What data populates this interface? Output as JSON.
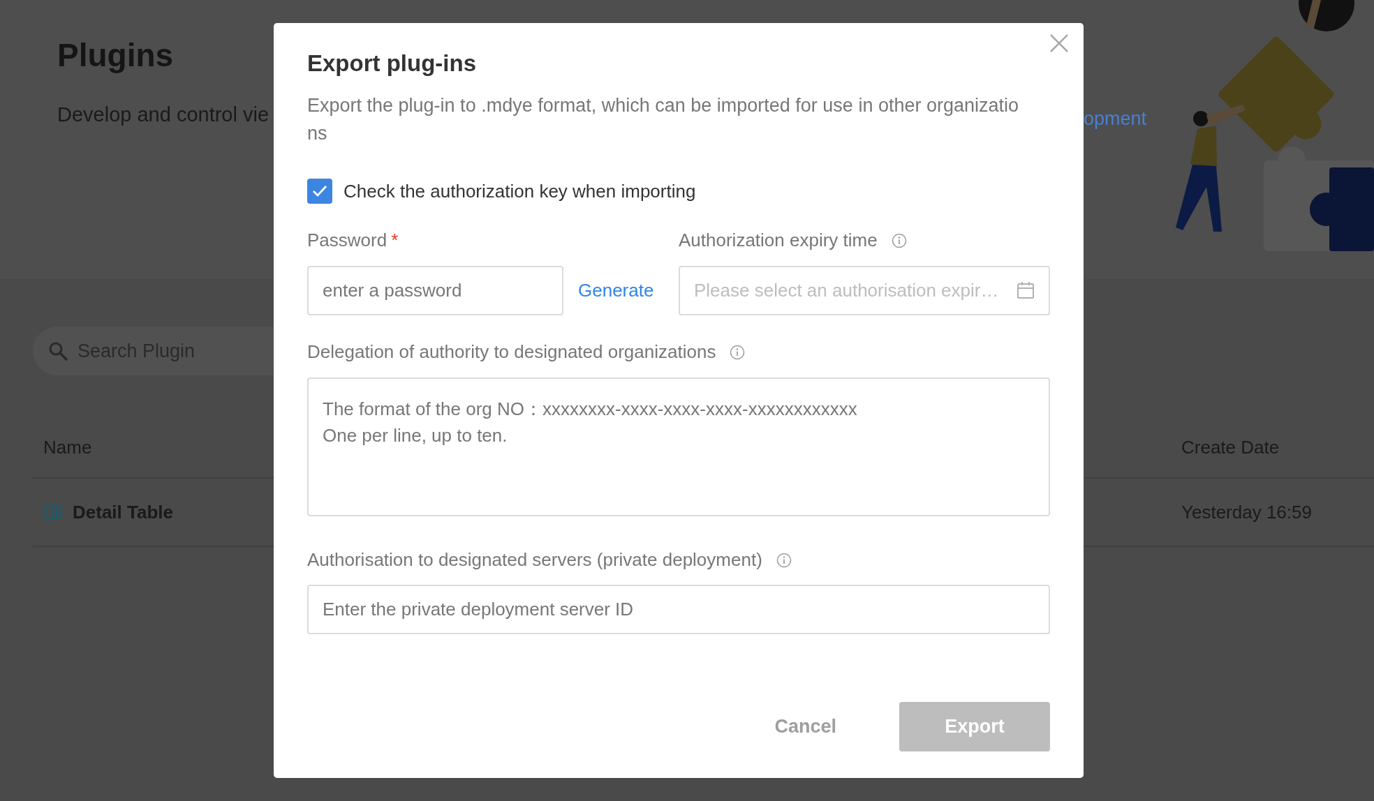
{
  "page": {
    "title": "Plugins",
    "subtitle": "Develop and control vie",
    "link": "opment",
    "search": {
      "placeholder": "Search Plugin"
    },
    "table": {
      "columns": [
        "Name",
        "Create Date"
      ],
      "rows": [
        {
          "name": "Detail Table",
          "create_date": "Yesterday 16:59"
        }
      ]
    }
  },
  "dialog": {
    "title": "Export plug-ins",
    "description": "Export the plug-in to .mdye format, which can be imported for use in other organizations",
    "checkbox": {
      "label": "Check the authorization key when importing",
      "checked": true
    },
    "password": {
      "label": "Password",
      "required_mark": "*",
      "info": false,
      "placeholder": "enter a password",
      "action": "Generate"
    },
    "expiry": {
      "label": "Authorization expiry time",
      "info": true,
      "placeholder": "Please select an authorisation expir…"
    },
    "organizations": {
      "label": "Delegation of authority to designated organizations",
      "info": true,
      "placeholder": "The format of the org NO：xxxxxxxx-xxxx-xxxx-xxxx-xxxxxxxxxxxx\nOne per line, up to ten."
    },
    "servers": {
      "label": "Authorisation to designated servers (private deployment)",
      "info": true,
      "placeholder": "Enter the private deployment server ID"
    },
    "buttons": [
      {
        "label": "Cancel",
        "kind": "text",
        "disabled": false
      },
      {
        "label": "Export",
        "kind": "primary",
        "disabled": true
      }
    ]
  }
}
